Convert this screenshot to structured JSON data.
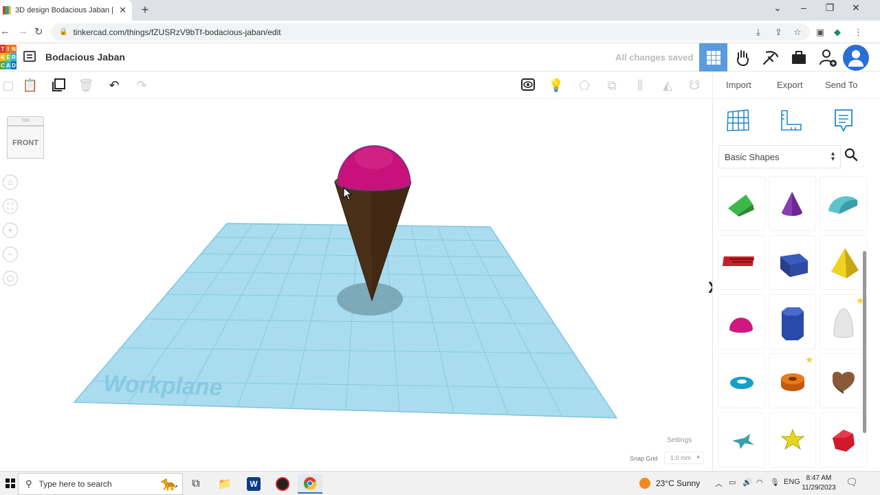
{
  "browser": {
    "tab_title": "3D design Bodacious Jaban | Tir",
    "url": "tinkercad.com/things/fZUSRzV9bTf-bodacious-jaban/edit"
  },
  "header": {
    "logo_letters": [
      "T",
      "I",
      "N",
      "K",
      "E",
      "R",
      "C",
      "A",
      "D"
    ],
    "design_name": "Bodacious Jaban",
    "save_status": "All changes saved"
  },
  "toolbar": {
    "import": "Import",
    "export": "Export",
    "send_to": "Send To"
  },
  "viewcube": {
    "top": "TOP",
    "front": "FRONT"
  },
  "workplane": {
    "label": "Workplane",
    "settings": "Settings",
    "snap_grid_label": "Snap Grid",
    "snap_grid_value": "1.0 mm"
  },
  "panel": {
    "category": "Basic Shapes",
    "shapes": [
      "Roof",
      "Cone",
      "Half Cylinder",
      "Text",
      "Box",
      "Pyramid",
      "Half Sphere",
      "Polygon",
      "Paraboloid",
      "Torus",
      "Tube",
      "Heart",
      "Star",
      "Star Round",
      "Icosahedron"
    ]
  },
  "taskbar": {
    "search_placeholder": "Type here to search",
    "weather": "23°C  Sunny",
    "lang": "ENG",
    "time": "8:47 AM",
    "date": "11/29/2023"
  },
  "colors": {
    "accent": "#5a9be0",
    "workplane": "#9ed8ec",
    "cone": "#4a2f1a",
    "sphere": "#c8117a"
  }
}
